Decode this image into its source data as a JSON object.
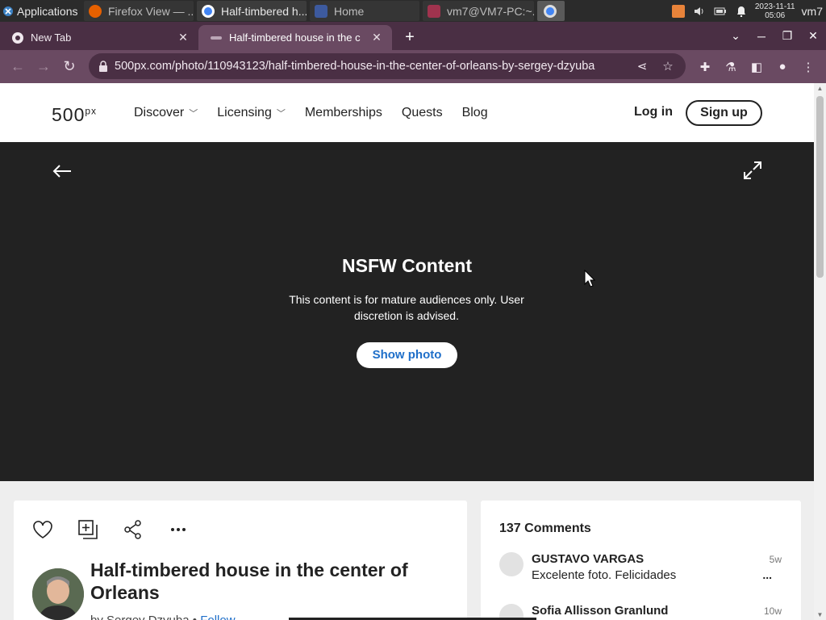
{
  "taskbar": {
    "apps_label": "Applications",
    "tasks": [
      {
        "label": "Firefox View — ...",
        "color": "#e66000"
      },
      {
        "label": "Half-timbered h...",
        "color": "#4285f4"
      },
      {
        "label": "Home",
        "color": "#3d5a9e"
      },
      {
        "label": "vm7@VM7-PC:~...",
        "color": "#a0334e"
      }
    ],
    "clock_date": "2023-11-11",
    "clock_time": "05:06",
    "user": "vm7"
  },
  "browser": {
    "tabs": [
      {
        "title": "New Tab",
        "close": "✕"
      },
      {
        "title": "Half-timbered house in the c",
        "close": "✕"
      }
    ],
    "new_tab": "+",
    "url": "500px.com/photo/110943123/half-timbered-house-in-the-center-of-orleans-by-sergey-dzyuba"
  },
  "site": {
    "logo": "500",
    "logo_sup": "px",
    "nav": [
      {
        "label": "Discover",
        "dropdown": true
      },
      {
        "label": "Licensing",
        "dropdown": true
      },
      {
        "label": "Memberships",
        "dropdown": false
      },
      {
        "label": "Quests",
        "dropdown": false
      },
      {
        "label": "Blog",
        "dropdown": false
      }
    ],
    "login": "Log in",
    "signup": "Sign up"
  },
  "photo": {
    "nsfw_title": "NSFW Content",
    "nsfw_text": "This content is for mature audiences only. User discretion is advised.",
    "show_button": "Show photo",
    "title": "Half-timbered house in the center of Orleans",
    "by_prefix": "by Sergey Dzyuba",
    "separator": "•",
    "follow": "Follow"
  },
  "comments": {
    "count_label": "137 Comments",
    "items": [
      {
        "name": "GUSTAVO VARGAS",
        "text": "Excelente foto. Felicidades",
        "time": "5w",
        "more": "..."
      },
      {
        "name": "Sofia Allisson Granlund",
        "text": "",
        "time": "10w"
      }
    ]
  }
}
